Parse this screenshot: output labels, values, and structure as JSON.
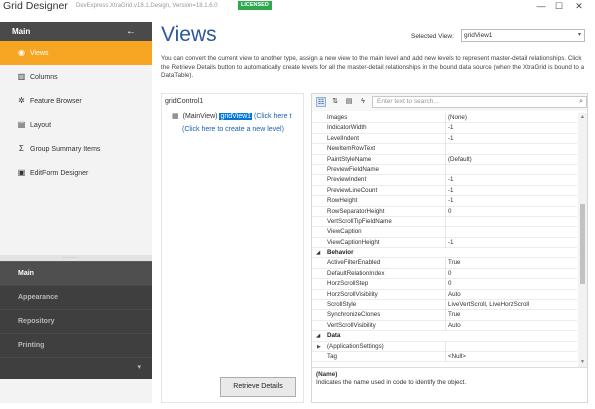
{
  "app": {
    "title": "Grid Designer",
    "subtitle": "DevExpress.XtraGrid.v18.1.Design, Version=18.1.6.0",
    "license": "LICENSED",
    "minimize": "—",
    "maximize": "☐",
    "close": "✕"
  },
  "sidebar": {
    "header": "Main",
    "collapse_icon": "←",
    "items": [
      {
        "label": "Views",
        "icon": "eye-icon",
        "glyph": "◉",
        "active": true
      },
      {
        "label": "Columns",
        "icon": "columns-icon",
        "glyph": "▥",
        "active": false
      },
      {
        "label": "Feature Browser",
        "icon": "gear-icon",
        "glyph": "✲",
        "active": false
      },
      {
        "label": "Layout",
        "icon": "layout-icon",
        "glyph": "▤",
        "active": false
      },
      {
        "label": "Group Summary Items",
        "icon": "sigma-icon",
        "glyph": "Σ",
        "active": false
      },
      {
        "label": "EditForm Designer",
        "icon": "form-icon",
        "glyph": "▣",
        "active": false
      }
    ],
    "groups": [
      {
        "label": "Main",
        "dim": false
      },
      {
        "label": "Appearance",
        "dim": true
      },
      {
        "label": "Repository",
        "dim": true
      },
      {
        "label": "Printing",
        "dim": true
      }
    ],
    "bottom_icon": "▾",
    "grip": "·····"
  },
  "main": {
    "title": "Views",
    "selected_view_label": "Selected View:",
    "selected_view_value": "gridView1",
    "description": "You can convert the current view to another type, assign a new view to the main level and add new levels to represent master-detail relationships. Click the Retrieve Details button to automatically create levels for all the master-detail relationships in the bound data source (when the XtraGrid is bound to a DataTable)."
  },
  "tree": {
    "root": "gridControl1",
    "main_view": "(MainView)",
    "view_name": "gridView1",
    "change_link": "(Click here t",
    "new_level_link": "(Click here to create a new level)",
    "retrieve_button": "Retrieve Details"
  },
  "property_grid": {
    "search_placeholder": "Enter text to search...",
    "rows": [
      {
        "name": "Images",
        "value": "(None)"
      },
      {
        "name": "IndicatorWidth",
        "value": "-1"
      },
      {
        "name": "LevelIndent",
        "value": "-1"
      },
      {
        "name": "NewItemRowText",
        "value": ""
      },
      {
        "name": "PaintStyleName",
        "value": "(Default)"
      },
      {
        "name": "PreviewFieldName",
        "value": ""
      },
      {
        "name": "PreviewIndent",
        "value": "-1"
      },
      {
        "name": "PreviewLineCount",
        "value": "-1"
      },
      {
        "name": "RowHeight",
        "value": "-1"
      },
      {
        "name": "RowSeparatorHeight",
        "value": "0"
      },
      {
        "name": "VertScrollTipFieldName",
        "value": ""
      },
      {
        "name": "ViewCaption",
        "value": ""
      },
      {
        "name": "ViewCaptionHeight",
        "value": "-1"
      },
      {
        "category": "Behavior",
        "toggle": "◢"
      },
      {
        "name": "ActiveFilterEnabled",
        "value": "True"
      },
      {
        "name": "DefaultRelationIndex",
        "value": "0"
      },
      {
        "name": "HorzScrollStep",
        "value": "0"
      },
      {
        "name": "HorzScrollVisibility",
        "value": "Auto"
      },
      {
        "name": "ScrollStyle",
        "value": "LiveVertScroll, LiveHorzScroll"
      },
      {
        "name": "SynchronizeClones",
        "value": "True"
      },
      {
        "name": "VertScrollVisibility",
        "value": "Auto"
      },
      {
        "category": "Data",
        "toggle": "◢"
      },
      {
        "name": "(ApplicationSettings)",
        "value": "",
        "expandable": true,
        "expander": "▶"
      },
      {
        "name": "Tag",
        "value": "<Null>"
      }
    ],
    "selected_property": "(Name)",
    "selected_description": "Indicates the name used in code to identify the object."
  }
}
